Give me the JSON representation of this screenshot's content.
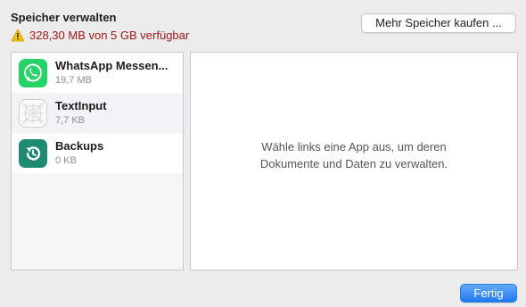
{
  "header": {
    "title": "Speicher verwalten",
    "storage_status": "328,30 MB von 5 GB verfügbar",
    "warning_icon": "warning-triangle-icon",
    "warning_color": "#a1181a"
  },
  "toolbar": {
    "buy_more_label": "Mehr Speicher kaufen ..."
  },
  "apps": [
    {
      "name": "WhatsApp Messenger",
      "display_name": "WhatsApp Messen...",
      "size": "19,7 MB",
      "icon": "whatsapp-icon",
      "color": "#25d366"
    },
    {
      "name": "TextInput",
      "display_name": "TextInput",
      "size": "7,7 KB",
      "icon": "textinput-grid-icon",
      "color": "#e6e6e6"
    },
    {
      "name": "Backups",
      "display_name": "Backups",
      "size": "0 KB",
      "icon": "backup-restore-icon",
      "color": "#1f8a70"
    }
  ],
  "detail": {
    "hint": "Wähle links eine App aus, um deren\nDokumente und Daten zu verwalten."
  },
  "footer": {
    "done_label": "Fertig",
    "accent_color": "#1f7af0"
  }
}
